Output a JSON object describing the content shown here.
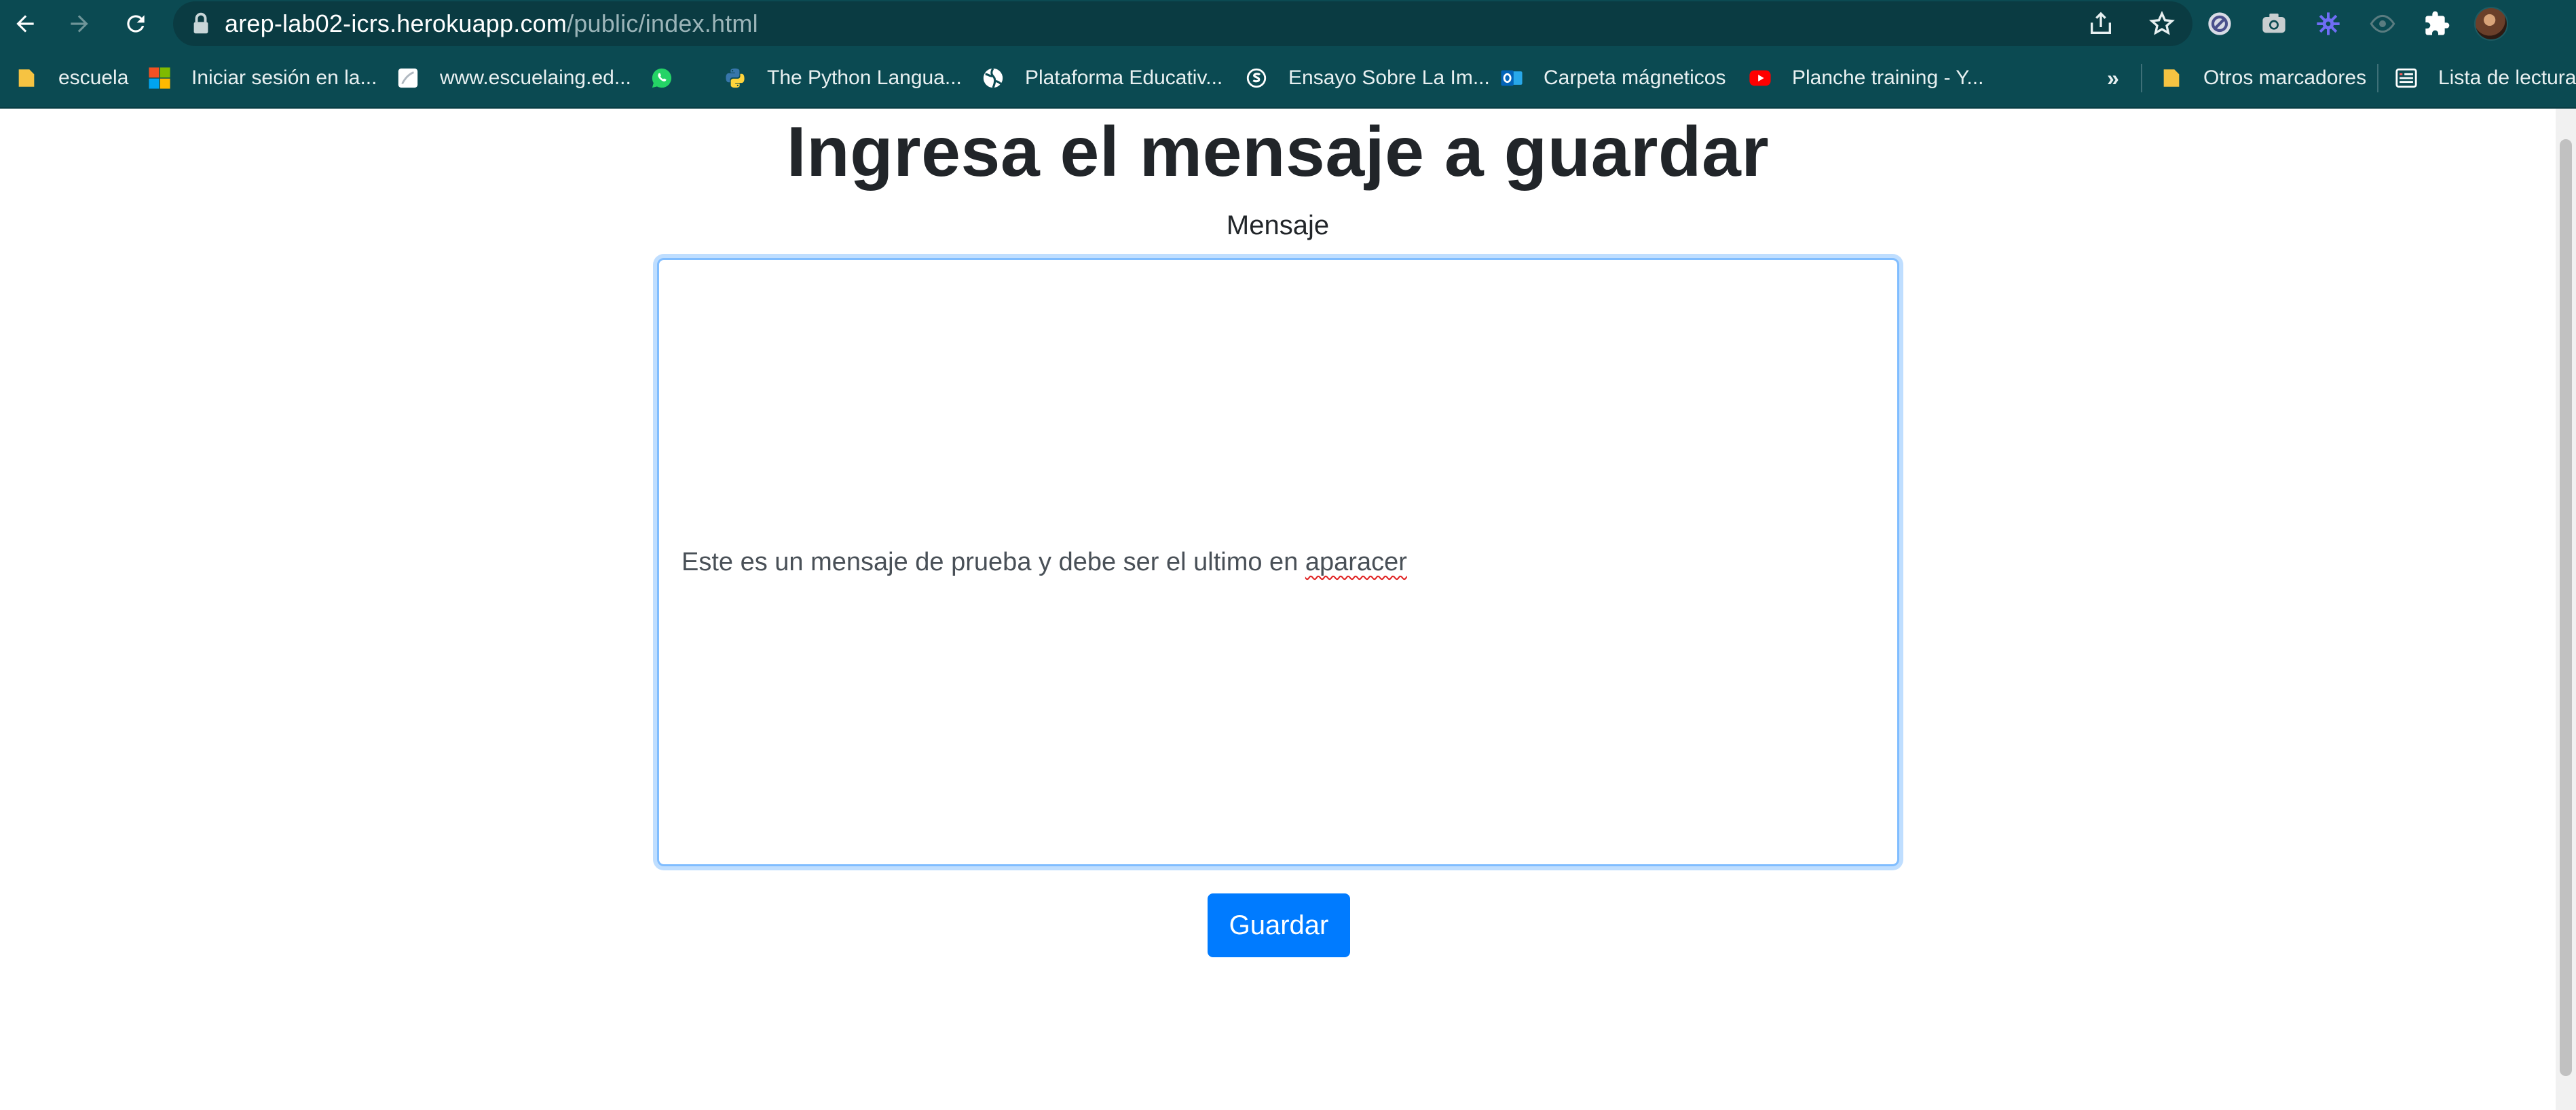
{
  "browser": {
    "url_host": "arep-lab02-icrs.herokuapp.com",
    "url_path": "/public/index.html",
    "icons": {
      "back": "back-arrow-icon",
      "forward": "forward-arrow-icon",
      "reload": "reload-icon",
      "lock": "lock-icon",
      "share": "share-icon",
      "bookmark_star": "star-icon",
      "extensions": [
        "blocker-extension-icon",
        "camera-extension-icon",
        "gear-extension-icon",
        "eye-extension-icon",
        "puzzle-icon"
      ],
      "profile": "avatar"
    }
  },
  "bookmarks": {
    "items": [
      {
        "label": "escuela",
        "icon": "folder-icon"
      },
      {
        "label": "Iniciar sesión en la...",
        "icon": "microsoft-icon"
      },
      {
        "label": "www.escuelaing.ed...",
        "icon": "page-icon"
      },
      {
        "label": "",
        "icon": "whatsapp-icon"
      },
      {
        "label": "The Python Langua...",
        "icon": "python-icon"
      },
      {
        "label": "Plataforma Educativ...",
        "icon": "globe-icon"
      },
      {
        "label": "Ensayo Sobre La Im...",
        "icon": "s-logo-icon"
      },
      {
        "label": "Carpeta mágneticos",
        "icon": "outlook-icon"
      },
      {
        "label": "Planche training - Y...",
        "icon": "youtube-icon"
      }
    ],
    "overflow": "»",
    "other_bookmarks": {
      "label": "Otros marcadores",
      "icon": "folder-icon"
    },
    "reading_list": {
      "label": "Lista de lectura",
      "icon": "reading-list-icon"
    }
  },
  "page": {
    "title": "Ingresa el mensaje a guardar",
    "field_label": "Mensaje",
    "message_text": "Este es un mensaje de prueba y debe ser el ultimo en ",
    "message_misspelled": "aparacer",
    "save_button": "Guardar"
  },
  "colors": {
    "toolbar": "#0b4a52",
    "omnibox": "#0a3b42",
    "primary_button": "#007bff",
    "focus_border": "#80bdff",
    "heading": "#212529"
  }
}
